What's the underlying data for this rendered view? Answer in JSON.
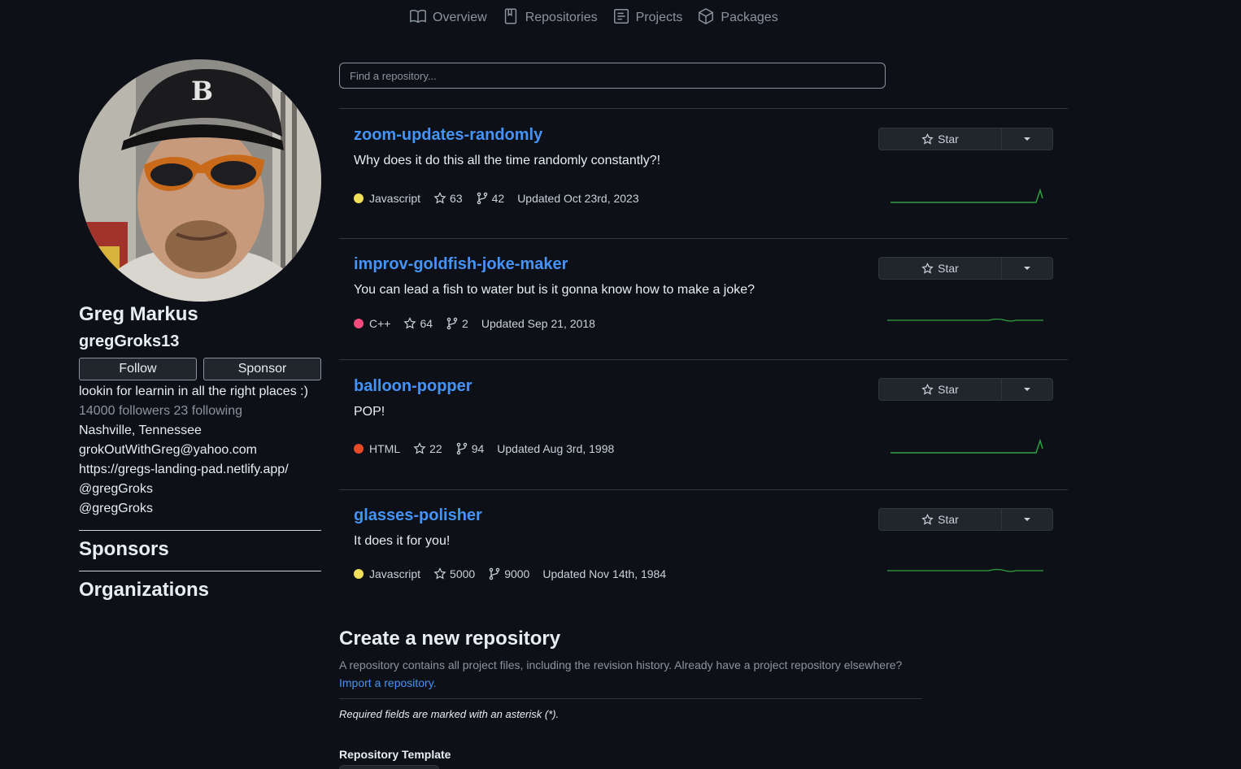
{
  "nav": {
    "items": [
      {
        "label": "Overview",
        "icon": "book-icon"
      },
      {
        "label": "Repositories",
        "icon": "repo-icon"
      },
      {
        "label": "Projects",
        "icon": "project-icon"
      },
      {
        "label": "Packages",
        "icon": "package-icon"
      }
    ]
  },
  "profile": {
    "name": "Greg Markus",
    "username": "gregGroks13",
    "follow_label": "Follow",
    "sponsor_label": "Sponsor",
    "bio": "lookin for learnin in all the right places :)",
    "followers_text": "14000 followers 23 following",
    "location": "Nashville, Tennessee",
    "email": "grokOutWithGreg@yahoo.com",
    "website": "https://gregs-landing-pad.netlify.app/",
    "handle_1": "@gregGroks",
    "handle_2": "@gregGroks",
    "sponsors_heading": "Sponsors",
    "organizations_heading": "Organizations"
  },
  "search": {
    "placeholder": "Find a repository..."
  },
  "repos": [
    {
      "name": "zoom-updates-randomly",
      "description": "Why does it do this all the time randomly constantly?!",
      "language": "Javascript",
      "lang_color": "#f1e05a",
      "stars": "63",
      "forks": "42",
      "updated": "Updated Oct 23rd, 2023",
      "star_label": "Star"
    },
    {
      "name": "improv-goldfish-joke-maker",
      "description": "You can lead a fish to water but is it gonna know how to make a joke?",
      "language": "C++",
      "lang_color": "#f34b7d",
      "stars": "64",
      "forks": "2",
      "updated": "Updated Sep 21, 2018",
      "star_label": "Star"
    },
    {
      "name": "balloon-popper",
      "description": "POP!",
      "language": "HTML",
      "lang_color": "#e34c26",
      "stars": "22",
      "forks": "94",
      "updated": "Updated Aug 3rd, 1998",
      "star_label": "Star"
    },
    {
      "name": "glasses-polisher",
      "description": "It does it for you!",
      "language": "Javascript",
      "lang_color": "#f1e05a",
      "stars": "5000",
      "forks": "9000",
      "updated": "Updated Nov 14th, 1984",
      "star_label": "Star"
    }
  ],
  "create": {
    "title": "Create a new repository",
    "description": "A repository contains all project files, including the revision history. Already have a project repository elsewhere?",
    "import_link": "Import a repository.",
    "required_note": "Required fields are marked with an asterisk (*).",
    "template_label": "Repository Template"
  },
  "colors": {
    "background": "#0d1117",
    "link": "#4493f8",
    "sparkline": "#2ea043"
  }
}
